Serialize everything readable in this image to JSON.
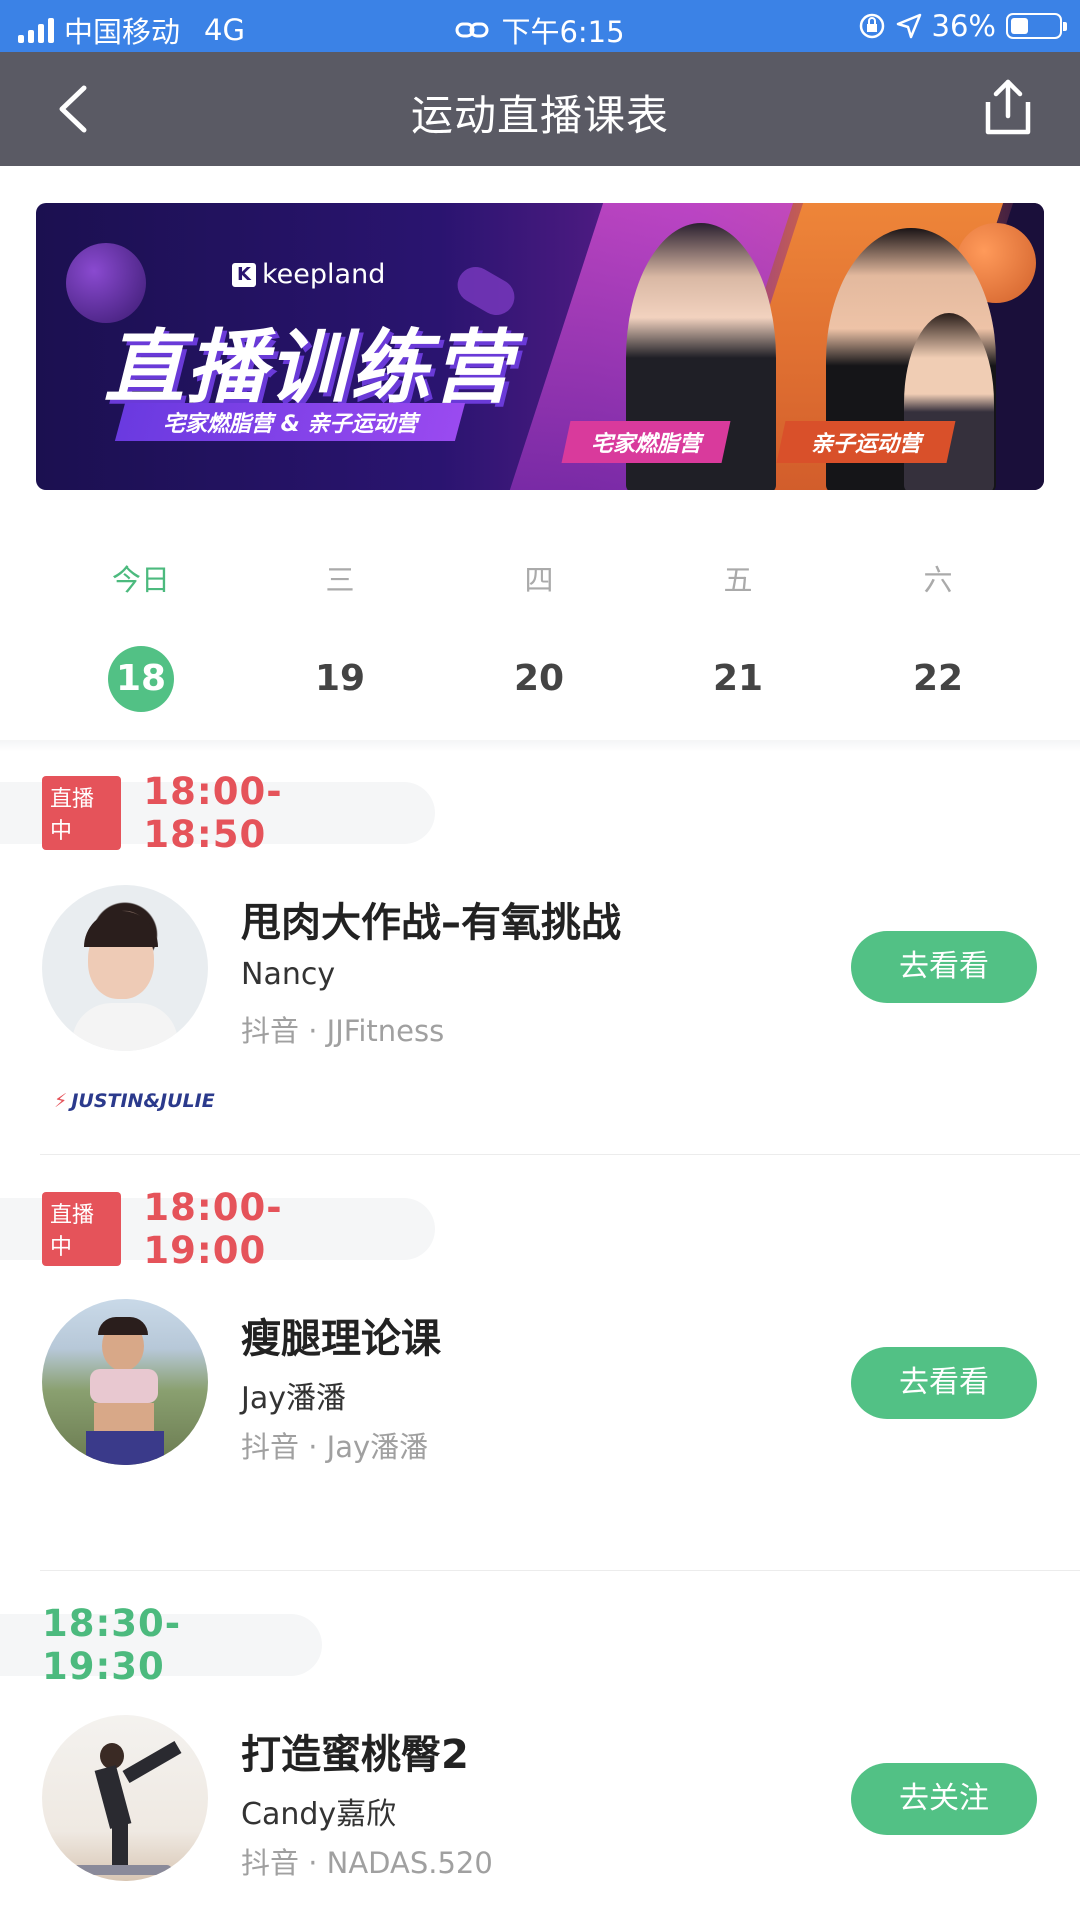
{
  "status_bar": {
    "carrier": "中国移动",
    "network": "4G",
    "time": "下午6:15",
    "battery": "36%",
    "battery_level": 0.36
  },
  "nav": {
    "title": "运动直播课表"
  },
  "banner": {
    "logo": "keepland",
    "title": "直播训练营",
    "subtitle": "宅家燃脂营 & 亲子运动营",
    "tag1": "宅家燃脂营",
    "tag2": "亲子运动营"
  },
  "week": {
    "days": [
      {
        "name": "今日",
        "date": "18"
      },
      {
        "name": "三",
        "date": "19"
      },
      {
        "name": "四",
        "date": "20"
      },
      {
        "name": "五",
        "date": "21"
      },
      {
        "name": "六",
        "date": "22"
      }
    ]
  },
  "sessions": [
    {
      "live_label": "直播中",
      "time": "18:00-18:50",
      "title": "甩肉大作战–有氧挑战",
      "coach": "Nancy",
      "platform": "抖音 · JJFitness",
      "button": "去看看",
      "brand": "JUSTIN&JULIE"
    },
    {
      "live_label": "直播中",
      "time": "18:00-19:00",
      "title": "瘦腿理论课",
      "coach": "Jay潘潘",
      "platform": "抖音 · Jay潘潘",
      "button": "去看看"
    },
    {
      "time": "18:30-19:30",
      "title": "打造蜜桃臀2",
      "coach": "Candy嘉欣",
      "platform": "抖音 · NADAS.520",
      "button": "去关注"
    }
  ],
  "colors": {
    "accent_green": "#52c185",
    "live_red": "#e5535a",
    "nav_bg": "#5a5a64",
    "status_bg": "#3b82e6"
  },
  "icons": {
    "back": "chevron-left-icon",
    "share": "share-icon",
    "link": "link-icon",
    "lock": "rotation-lock-icon",
    "location": "location-arrow-icon"
  }
}
